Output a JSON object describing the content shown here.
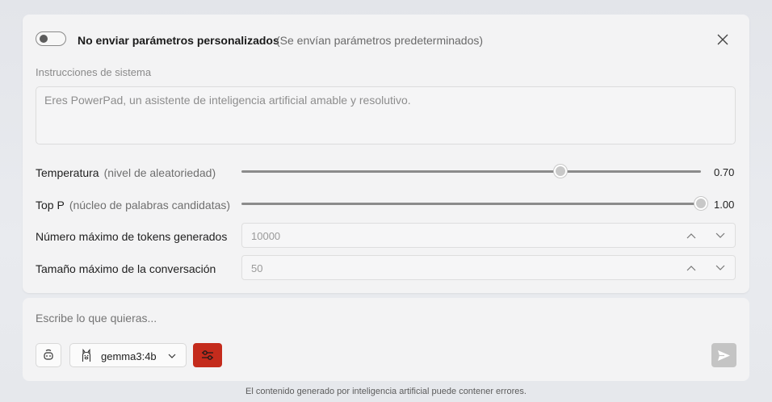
{
  "params_panel": {
    "toggle_on": false,
    "title": "No enviar parámetros personalizados",
    "subtitle": "(Se envían parámetros predeterminados)",
    "system_instructions": {
      "label": "Instrucciones de sistema",
      "placeholder": "Eres PowerPad, un asistente de inteligencia artificial amable y resolutivo."
    },
    "temperature": {
      "label": "Temperatura",
      "hint": "(nivel de aleatoriedad)",
      "value": 0.7,
      "value_text": "0.70",
      "fraction": 0.694
    },
    "top_p": {
      "label": "Top P",
      "hint": "(núcleo de palabras candidatas)",
      "value": 1.0,
      "value_text": "1.00",
      "fraction": 1.0
    },
    "max_tokens": {
      "label": "Número máximo de tokens generados",
      "placeholder": "10000"
    },
    "max_context": {
      "label": "Tamaño máximo de la conversación",
      "placeholder": "50"
    }
  },
  "chat": {
    "placeholder": "Escribe lo que quieras...",
    "model_name": "gemma3:4b",
    "accent_color": "#c42b1c"
  },
  "icons": [
    "close-icon",
    "robot-icon",
    "llama-icon",
    "chevron-down-icon",
    "chevron-up-icon",
    "sliders-icon",
    "send-icon"
  ],
  "footer": {
    "disclaimer": "El contenido generado por inteligencia artificial puede contener errores."
  }
}
